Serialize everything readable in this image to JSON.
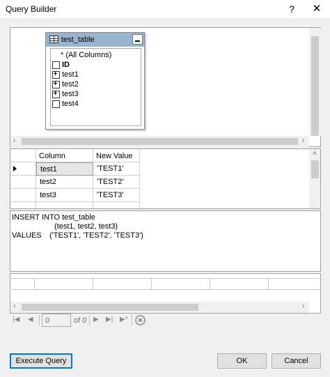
{
  "window": {
    "title": "Query Builder",
    "help_label": "?",
    "close_label": "✕"
  },
  "diagram": {
    "table_name": "test_table",
    "columns": [
      {
        "label": "* (All Columns)",
        "marker": "none",
        "bold": false
      },
      {
        "label": "ID",
        "marker": "checkbox",
        "bold": true
      },
      {
        "label": "test1",
        "marker": "plus",
        "bold": false
      },
      {
        "label": "test2",
        "marker": "plus",
        "bold": false
      },
      {
        "label": "test3",
        "marker": "plus",
        "bold": false
      },
      {
        "label": "test4",
        "marker": "checkbox",
        "bold": false
      }
    ]
  },
  "grid": {
    "headers": [
      "Column",
      "New Value"
    ],
    "rows": [
      {
        "column": "test1",
        "value": "'TEST1'"
      },
      {
        "column": "test2",
        "value": "'TEST2'"
      },
      {
        "column": "test3",
        "value": "'TEST3'"
      }
    ]
  },
  "sql": {
    "line1": "INSERT INTO test_table",
    "line2": "(test1, test2, test3)",
    "line3_keyword": "VALUES",
    "line3_values": "('TEST1', 'TEST2', 'TEST3')"
  },
  "navigation": {
    "page_value": "0",
    "page_of": "of 0"
  },
  "buttons": {
    "execute": "Execute Query",
    "ok": "OK",
    "cancel": "Cancel"
  },
  "icons": {
    "first": "first-record-icon",
    "prev": "previous-record-icon",
    "next": "next-record-icon",
    "last": "last-record-icon",
    "new": "new-record-icon",
    "stop": "stop-icon"
  },
  "colors": {
    "table_header": "#99b4d1",
    "focus_border": "#0078d7"
  }
}
